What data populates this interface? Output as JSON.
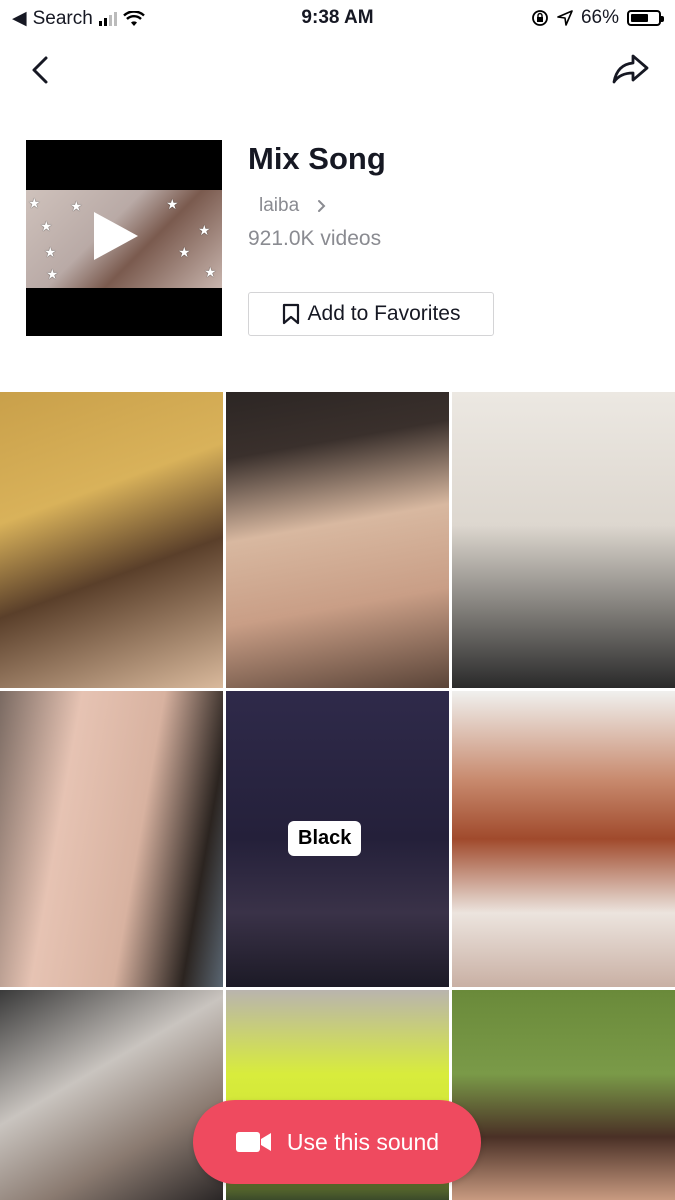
{
  "status_bar": {
    "back_app": "Search",
    "time": "9:38 AM",
    "battery": "66%",
    "battery_level": 0.66
  },
  "sound": {
    "title": "Mix Song",
    "author": "laiba",
    "videos": "921.0K videos"
  },
  "actions": {
    "favorite": "Add to Favorites",
    "use_sound": "Use this sound"
  },
  "grid": {
    "sticker_text": "Black"
  },
  "colors": {
    "accent": "#ef4a5f",
    "text_primary": "#161823",
    "text_secondary": "#8a8b91"
  }
}
